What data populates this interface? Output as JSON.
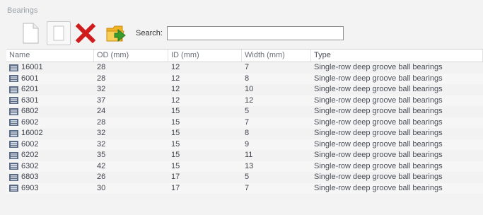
{
  "window": {
    "title": "Bearings"
  },
  "toolbar": {
    "new_icon": "new-document-icon",
    "copy_icon": "copy-icon",
    "delete_icon": "delete-x-icon",
    "open_icon": "open-folder-icon",
    "search_label": "Search:",
    "search_value": ""
  },
  "colors": {
    "delete_red": "#d01c1c",
    "folder_yellow": "#f0b323",
    "arrow_green": "#3a9a2a"
  },
  "table": {
    "columns": [
      "Name",
      "OD (mm)",
      "ID (mm)",
      "Width (mm)",
      "Type"
    ],
    "rows": [
      {
        "name": "16001",
        "od": "28",
        "id": "12",
        "width": "7",
        "type": "Single-row deep groove ball bearings"
      },
      {
        "name": "6001",
        "od": "28",
        "id": "12",
        "width": "8",
        "type": "Single-row deep groove ball bearings"
      },
      {
        "name": "6201",
        "od": "32",
        "id": "12",
        "width": "10",
        "type": "Single-row deep groove ball bearings"
      },
      {
        "name": "6301",
        "od": "37",
        "id": "12",
        "width": "12",
        "type": "Single-row deep groove ball bearings"
      },
      {
        "name": "6802",
        "od": "24",
        "id": "15",
        "width": "5",
        "type": "Single-row deep groove ball bearings"
      },
      {
        "name": "6902",
        "od": "28",
        "id": "15",
        "width": "7",
        "type": "Single-row deep groove ball bearings"
      },
      {
        "name": "16002",
        "od": "32",
        "id": "15",
        "width": "8",
        "type": "Single-row deep groove ball bearings"
      },
      {
        "name": "6002",
        "od": "32",
        "id": "15",
        "width": "9",
        "type": "Single-row deep groove ball bearings"
      },
      {
        "name": "6202",
        "od": "35",
        "id": "15",
        "width": "11",
        "type": "Single-row deep groove ball bearings"
      },
      {
        "name": "6302",
        "od": "42",
        "id": "15",
        "width": "13",
        "type": "Single-row deep groove ball bearings"
      },
      {
        "name": "6803",
        "od": "26",
        "id": "17",
        "width": "5",
        "type": "Single-row deep groove ball bearings"
      },
      {
        "name": "6903",
        "od": "30",
        "id": "17",
        "width": "7",
        "type": "Single-row deep groove ball bearings"
      }
    ]
  }
}
